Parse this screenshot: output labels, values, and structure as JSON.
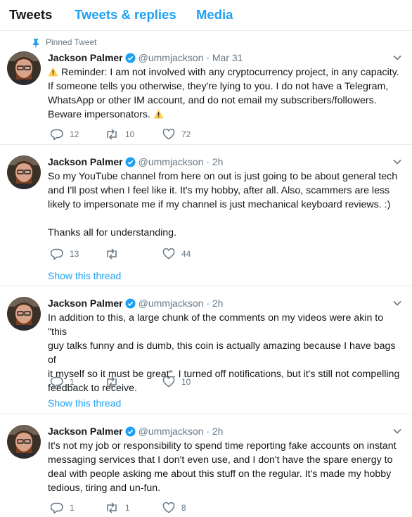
{
  "tabs": [
    "Tweets",
    "Tweets & replies",
    "Media"
  ],
  "colors": {
    "accent": "#1da1f2",
    "text": "#14171a",
    "secondary": "#657786",
    "divider": "#e6ecf0"
  },
  "pinned_label": "Pinned Tweet",
  "show_thread_label": "Show this thread",
  "tweets": [
    {
      "name": "Jackson Palmer",
      "handle": "@ummjackson",
      "dot": "·",
      "time": "Mar 31",
      "text_parts": [
        "Reminder: I am not involved with any cryptocurrency project, in any capacity.",
        "If someone tells you otherwise, they're lying to you. I do not have a Telegram,",
        "WhatsApp or other IM account, and do not email my subscribers/followers.",
        "Beware impersonators."
      ],
      "replies": "12",
      "retweets": "10",
      "likes": "72"
    },
    {
      "name": "Jackson Palmer",
      "handle": "@ummjackson",
      "dot": "·",
      "time": "2h",
      "text_lines": [
        "So my YouTube channel from here on out is just going to be about general tech",
        "and I'll post when I feel like it. It's my hobby, after all. Also, scammers are less",
        "likely to impersonate me if my channel is just mechanical keyboard reviews. :)",
        "",
        "Thanks all for understanding."
      ],
      "replies": "13",
      "retweets": "",
      "likes": "44"
    },
    {
      "name": "Jackson Palmer",
      "handle": "@ummjackson",
      "dot": "·",
      "time": "2h",
      "text_lines": [
        "In addition to this, a large chunk of the comments on my videos were akin to \"this",
        "guy talks funny and is dumb, this coin is actually amazing because I have bags of",
        "it myself so it must be great\". I turned off notifications, but it's still not compelling",
        "feedback to receive."
      ],
      "replies": "1",
      "retweets": "",
      "likes": "10"
    },
    {
      "name": "Jackson Palmer",
      "handle": "@ummjackson",
      "dot": "·",
      "time": "2h",
      "text_lines": [
        "It's not my job or responsibility to spend time reporting fake accounts on instant",
        "messaging services that I don't even use, and I don't have the spare energy to",
        "deal with people asking me about this stuff on the regular. It's made my hobby",
        "tedious, tiring and un-fun."
      ],
      "replies": "1",
      "retweets": "1",
      "likes": "8"
    }
  ]
}
